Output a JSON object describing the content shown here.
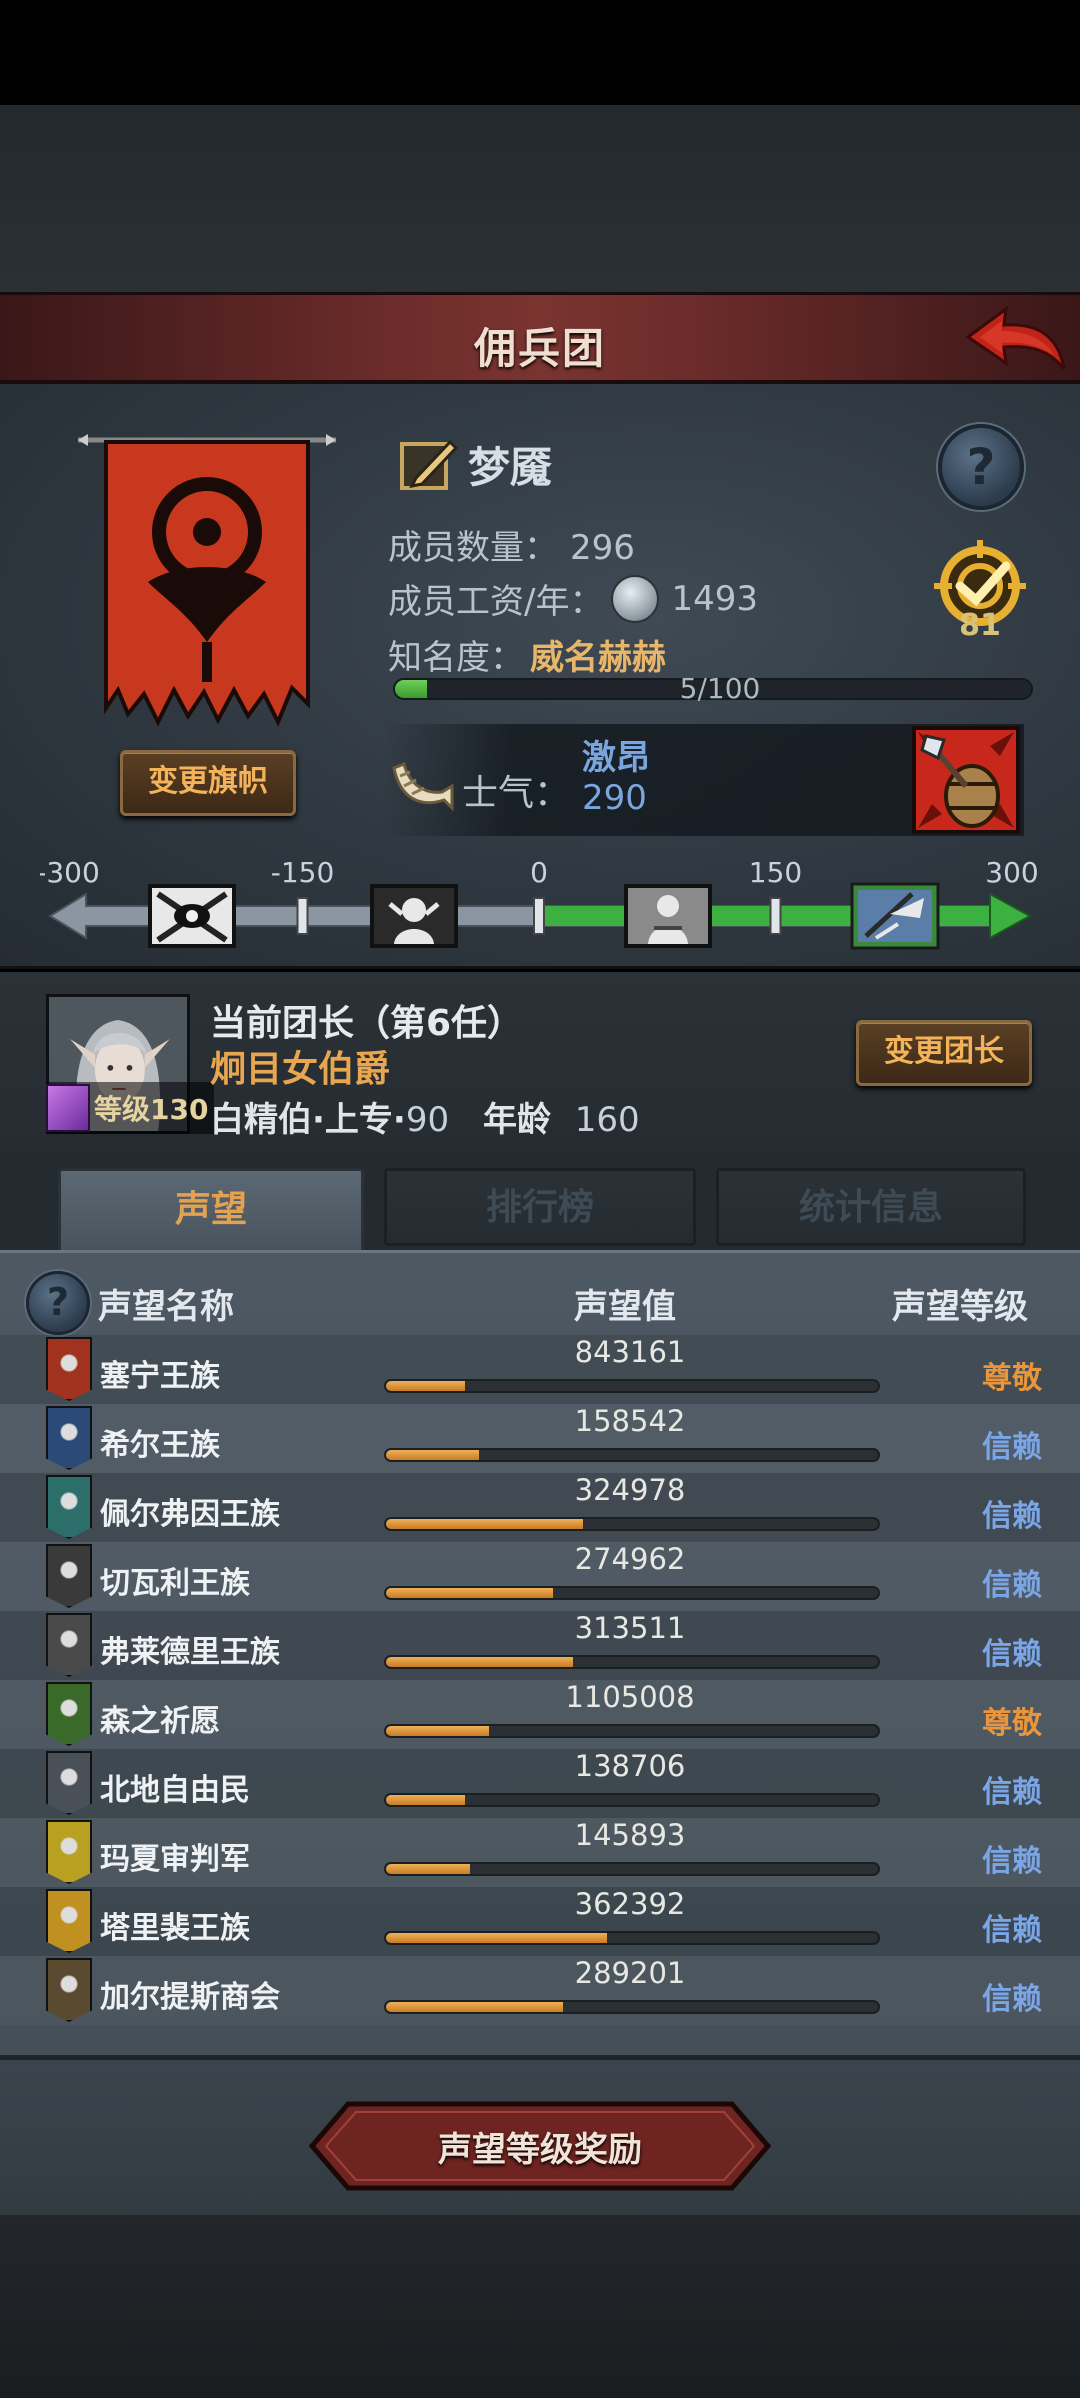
{
  "header": {
    "title": "佣兵团"
  },
  "mercenary": {
    "name": "梦魇",
    "member_count_label": "成员数量：",
    "member_count": "296",
    "wage_label": "成员工资/年：",
    "wage": "1493",
    "fame_label": "知名度：",
    "fame_value": "威名赫赫",
    "fame_progress_text": "5/100",
    "fame_progress": 0.05,
    "target_count": "81",
    "change_flag_label": "变更旗帜",
    "banner_color": "#c8381e"
  },
  "morale": {
    "label": "士气：",
    "state": "激昂",
    "value": "290",
    "ticks": [
      "-300",
      "-150",
      "0",
      "150",
      "300"
    ],
    "min": -300,
    "max": 300,
    "current": 290
  },
  "leader": {
    "title": "当前团长（第6任）",
    "name": "炯目女伯爵",
    "level_label": "等级130",
    "info_class": "白精伯·上专·",
    "info_class_num": "90",
    "age_label": "年龄",
    "age": "160",
    "change_leader_label": "变更团长"
  },
  "tabs": [
    {
      "label": "声望",
      "active": true
    },
    {
      "label": "排行榜",
      "active": false
    },
    {
      "label": "统计信息",
      "active": false
    }
  ],
  "reputation": {
    "columns": {
      "name": "声望名称",
      "value": "声望值",
      "level": "声望等级"
    },
    "rows": [
      {
        "name": "塞宁王族",
        "value": "843161",
        "level": "尊敬",
        "fill": 0.16,
        "icon_color": "#a0321e",
        "icon": "tree-sigil-icon"
      },
      {
        "name": "希尔王族",
        "value": "158542",
        "level": "信赖",
        "fill": 0.19,
        "icon_color": "#2c4a78",
        "icon": "skull-sigil-icon"
      },
      {
        "name": "佩尔弗因王族",
        "value": "324978",
        "level": "信赖",
        "fill": 0.4,
        "icon_color": "#2c6e6a",
        "icon": "crescent-sigil-icon"
      },
      {
        "name": "切瓦利王族",
        "value": "274962",
        "level": "信赖",
        "fill": 0.34,
        "icon_color": "#3a3a3a",
        "icon": "scales-sigil-icon"
      },
      {
        "name": "弗莱德里王族",
        "value": "313511",
        "level": "信赖",
        "fill": 0.38,
        "icon_color": "#4a4a4a",
        "icon": "wolf-sigil-icon"
      },
      {
        "name": "森之祈愿",
        "value": "1105008",
        "level": "尊敬",
        "fill": 0.21,
        "icon_color": "#3a6a2a",
        "icon": "forest-sigil-icon"
      },
      {
        "name": "北地自由民",
        "value": "138706",
        "level": "信赖",
        "fill": 0.16,
        "icon_color": "#4a5058",
        "icon": "axe-sigil-icon"
      },
      {
        "name": "玛夏审判军",
        "value": "145893",
        "level": "信赖",
        "fill": 0.17,
        "icon_color": "#b8a020",
        "icon": "sun-sigil-icon"
      },
      {
        "name": "塔里裴王族",
        "value": "362392",
        "level": "信赖",
        "fill": 0.45,
        "icon_color": "#c09020",
        "icon": "flame-sigil-icon"
      },
      {
        "name": "加尔提斯商会",
        "value": "289201",
        "level": "信赖",
        "fill": 0.36,
        "icon_color": "#5a4a30",
        "icon": "chest-sigil-icon"
      }
    ]
  },
  "reward_button": {
    "label": "声望等级奖励"
  }
}
